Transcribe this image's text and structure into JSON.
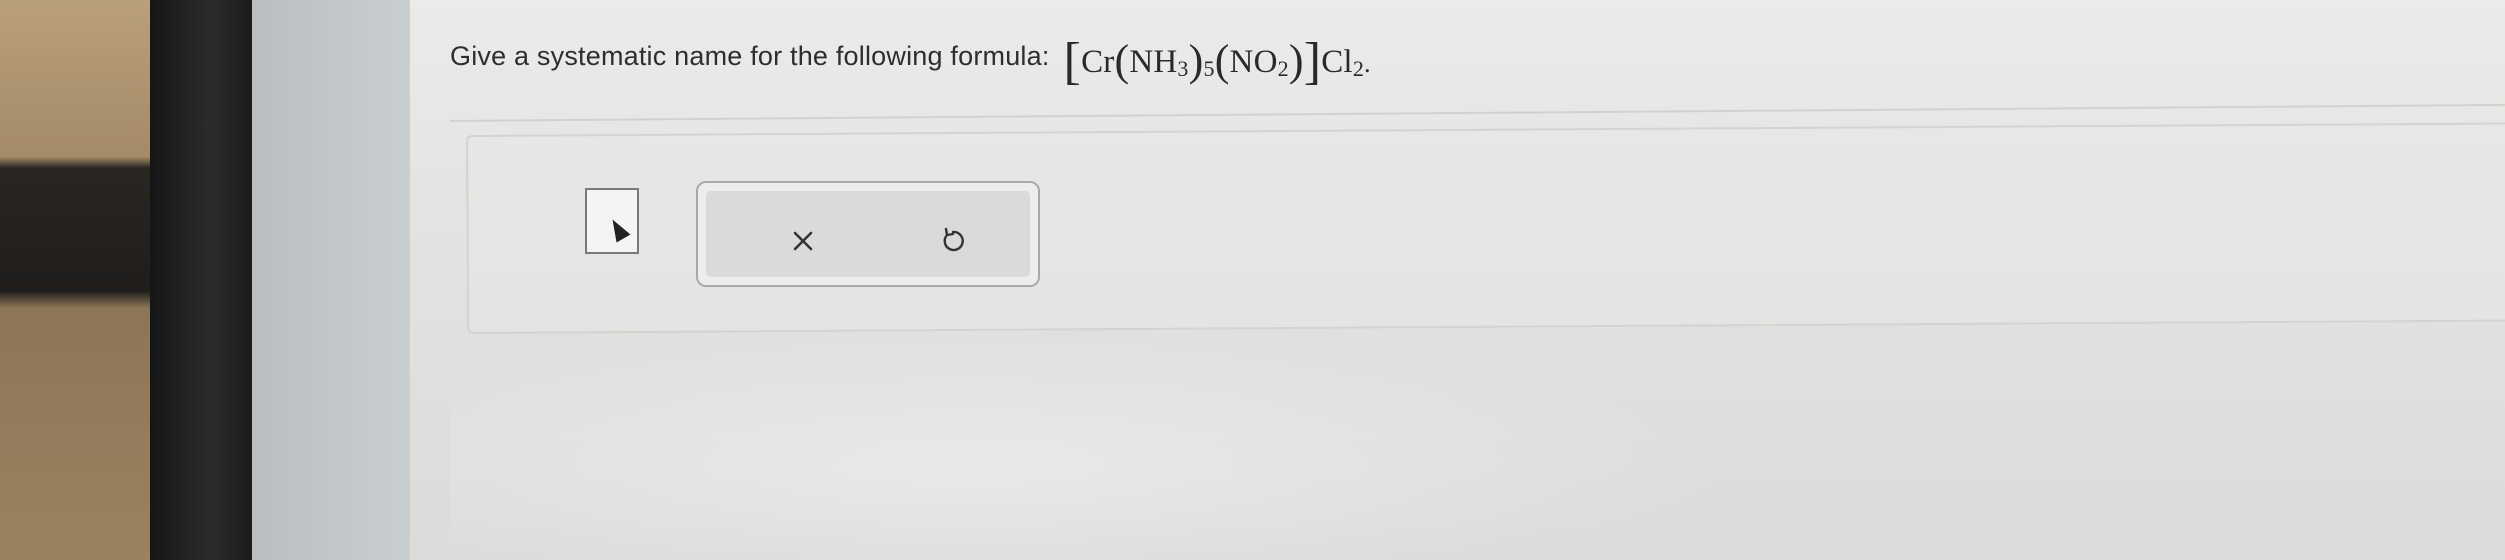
{
  "question": {
    "prompt": "Give a systematic name for the following formula:",
    "formula": {
      "metal": "Cr",
      "ligand1": "NH",
      "ligand1_sub": "3",
      "ligand1_count": "5",
      "ligand2": "NO",
      "ligand2_sub": "2",
      "counter_ion": "Cl",
      "counter_ion_sub": "2",
      "end_mark": "."
    }
  },
  "answer": {
    "value": ""
  },
  "toolbar": {
    "clear_icon": "close-icon",
    "undo_icon": "undo-icon"
  },
  "colors": {
    "screen_bg": "#e4e3e1",
    "text": "#2e2e2e",
    "toolbar_bg": "#d9dadb"
  }
}
